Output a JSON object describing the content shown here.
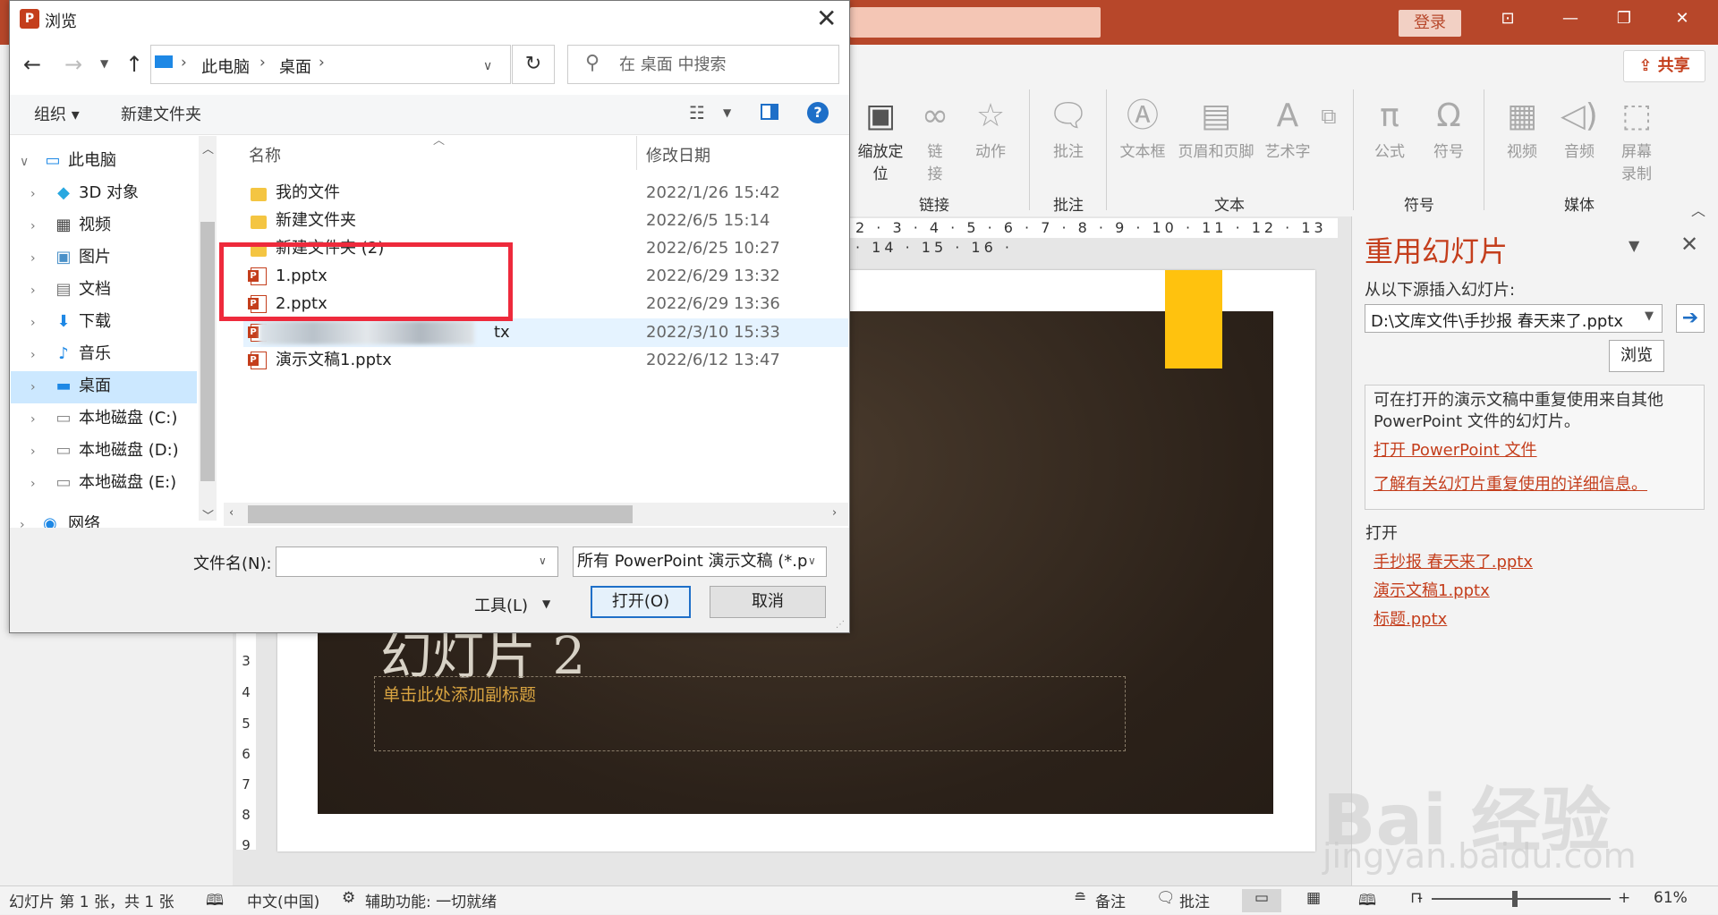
{
  "ppt": {
    "login_label": "登录",
    "share_label": "共享",
    "ribbon": {
      "zoom_label": "缩放定位",
      "link_label": "链接",
      "action_label": "动作",
      "comment_label": "批注",
      "textbox_label": "文本框",
      "header_footer_label": "页眉和页脚",
      "wordart_label": "艺术字",
      "equation_label": "公式",
      "symbol_label": "符号",
      "video_label": "视频",
      "audio_label": "音频",
      "screen_record_label": "屏幕录制",
      "groups": {
        "links": "链接",
        "comments": "批注",
        "text": "文本",
        "symbols": "符号",
        "media": "媒体"
      }
    },
    "ruler_text": "2 · 3 · 4 · 5 · 6 · 7 · 8 · 9 · 10 · 11 · 12 · 13 · 14 · 15 · 16 ·",
    "vruler": [
      "3",
      "4",
      "5",
      "6",
      "7",
      "8",
      "9"
    ],
    "slide": {
      "title": "幻灯片 2",
      "subtitle_placeholder": "单击此处添加副标题",
      "tab_color": "#ffc20e"
    }
  },
  "reuse_pane": {
    "title": "重用幻灯片",
    "subtitle": "从以下源插入幻灯片:",
    "source_value": "D:\\文库文件\\手抄报 春天来了.pptx",
    "browse_label": "浏览",
    "info_text": "可在打开的演示文稿中重复使用来自其他 PowerPoint 文件的幻灯片。",
    "open_ppt_link": "打开 PowerPoint 文件",
    "learn_more_link": "了解有关幻灯片重复使用的详细信息。",
    "open_heading": "打开",
    "recent_files": [
      "手抄报 春天来了.pptx",
      "演示文稿1.pptx",
      "标题.pptx"
    ]
  },
  "statusbar": {
    "slide_info": "幻灯片 第 1 张，共 1 张",
    "language": "中文(中国)",
    "accessibility": "辅助功能: 一切就绪",
    "notes_label": "备注",
    "comments_label": "批注",
    "zoom_minus": "-",
    "zoom_plus": "+",
    "zoom_percent": "61%"
  },
  "dialog": {
    "title": "浏览",
    "address": {
      "this_pc": "此电脑",
      "desktop": "桌面"
    },
    "search_placeholder": "在 桌面 中搜索",
    "toolbar": {
      "organize": "组织 ▾",
      "new_folder": "新建文件夹"
    },
    "tree": [
      {
        "label": "此电脑",
        "icon": "pc-icon"
      },
      {
        "label": "3D 对象",
        "icon": "cube-icon"
      },
      {
        "label": "视频",
        "icon": "video-icon"
      },
      {
        "label": "图片",
        "icon": "picture-icon"
      },
      {
        "label": "文档",
        "icon": "document-icon"
      },
      {
        "label": "下载",
        "icon": "download-icon"
      },
      {
        "label": "音乐",
        "icon": "music-icon"
      },
      {
        "label": "桌面",
        "icon": "desktop-icon"
      },
      {
        "label": "本地磁盘 (C:)",
        "icon": "drive-icon"
      },
      {
        "label": "本地磁盘 (D:)",
        "icon": "drive-icon"
      },
      {
        "label": "本地磁盘 (E:)",
        "icon": "drive-icon"
      },
      {
        "label": "网络",
        "icon": "network-icon"
      }
    ],
    "columns": {
      "name": "名称",
      "modified": "修改日期"
    },
    "files": [
      {
        "name": "我的文件",
        "date": "2022/1/26 15:42",
        "type": "folder"
      },
      {
        "name": "新建文件夹",
        "date": "2022/6/5 15:14",
        "type": "folder"
      },
      {
        "name": "新建文件夹 (2)",
        "date": "2022/6/25 10:27",
        "type": "folder"
      },
      {
        "name": "1.pptx",
        "date": "2022/6/29 13:32",
        "type": "pptx"
      },
      {
        "name": "2.pptx",
        "date": "2022/6/29 13:36",
        "type": "pptx"
      },
      {
        "name": "tx",
        "date": "2022/3/10 15:33",
        "type": "pptx"
      },
      {
        "name": "演示文稿1.pptx",
        "date": "2022/6/12 13:47",
        "type": "pptx"
      }
    ],
    "filename_label": "文件名(N):",
    "filename_value": "",
    "filter_value": "所有 PowerPoint 演示文稿 (*.p",
    "tools_label": "工具(L)",
    "open_label": "打开(O)",
    "cancel_label": "取消"
  },
  "watermark": {
    "logo": "Bai 经验",
    "url": "jingyan.baidu.com"
  }
}
